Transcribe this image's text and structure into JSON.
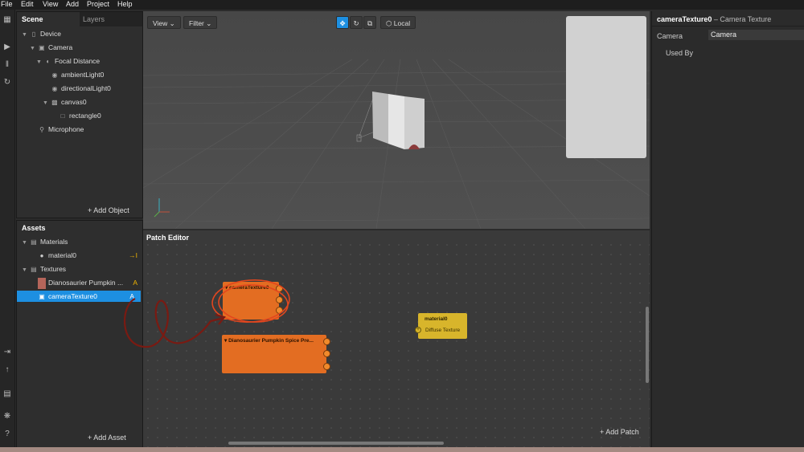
{
  "menu": [
    "File",
    "Edit",
    "View",
    "Add",
    "Project",
    "Help"
  ],
  "scene": {
    "tabs": [
      "Scene",
      "Layers"
    ],
    "items": [
      {
        "label": "Device",
        "icon": "device-icon"
      },
      {
        "label": "Camera",
        "icon": "camera-icon"
      },
      {
        "label": "Focal Distance",
        "icon": "focal-distance-icon"
      },
      {
        "label": "ambientLight0",
        "icon": "light-icon"
      },
      {
        "label": "directionalLight0",
        "icon": "light-icon"
      },
      {
        "label": "canvas0",
        "icon": "canvas-icon"
      },
      {
        "label": "rectangle0",
        "icon": "rectangle-icon"
      },
      {
        "label": "Microphone",
        "icon": "microphone-icon"
      }
    ],
    "add_object": "+ Add Object"
  },
  "assets": {
    "title": "Assets",
    "materials_folder": "Materials",
    "material0": "material0",
    "textures_folder": "Textures",
    "texture1": "Dianosaurier Pumpkin ...",
    "texture1_badge": "A",
    "texture2": "cameraTexture0",
    "texture2_badge": "A",
    "material_badge": "→I",
    "add_asset": "+ Add Asset"
  },
  "viewport": {
    "view_label": "View ⌄",
    "filter_label": "Filter ⌄",
    "local_label": "Local"
  },
  "inspector": {
    "title_bold": "cameraTexture0",
    "title_rest": " – Camera Texture",
    "camera_label": "Camera",
    "camera_value": "Camera",
    "used_by": "Used By"
  },
  "patch": {
    "title": "Patch Editor",
    "node_camera": "▾ cameraTexture0",
    "node_pumpkin": "▾ Dianosaurier Pumpkin Spice Pre...",
    "node_material": "material0",
    "material_input": "Diffuse Texture",
    "add_patch": "+ Add Patch"
  },
  "colors": {
    "accent": "#1d8fe1",
    "patch_node": "#e36d22",
    "material_node": "#d8b52b",
    "annotation_red": "#e2461e",
    "annotation_dark": "#7a1a12"
  }
}
